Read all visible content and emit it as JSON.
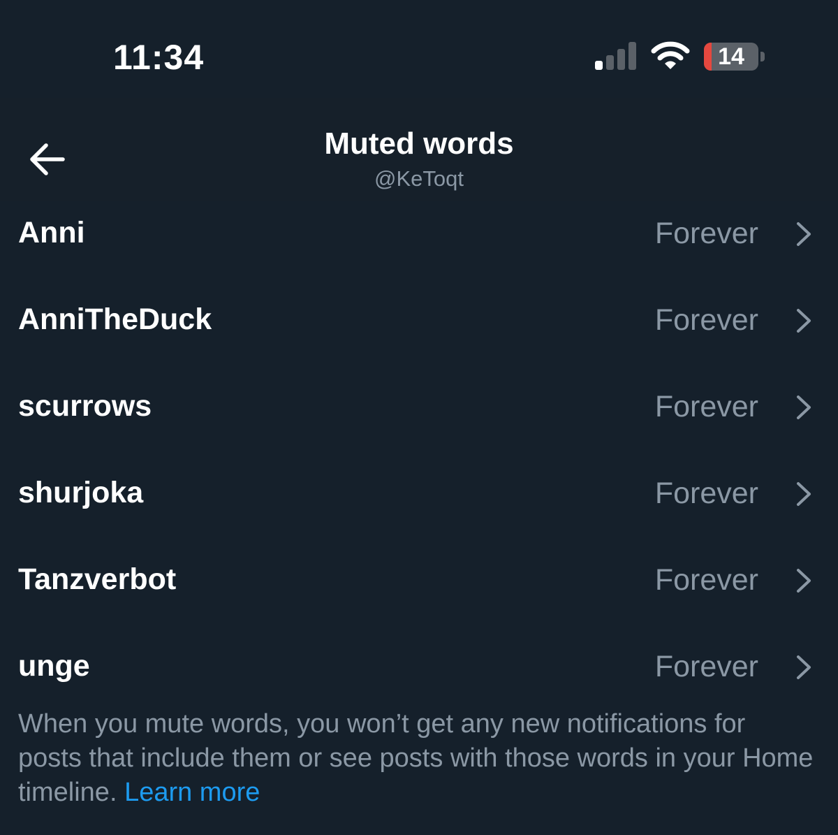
{
  "status_bar": {
    "time": "11:34",
    "signal_icon": "cellular-signal-icon",
    "signal_bars_active": 1,
    "signal_bars_total": 4,
    "wifi_icon": "wifi-icon",
    "battery_level": "14",
    "battery_fraction": 0.14,
    "battery_color": "#e5483f"
  },
  "header": {
    "back_icon": "back-arrow-icon",
    "title": "Muted words",
    "subtitle": "@KeToqt"
  },
  "muted_words": [
    {
      "word": "Anni",
      "duration": "Forever"
    },
    {
      "word": "AnniTheDuck",
      "duration": "Forever"
    },
    {
      "word": "scurrows",
      "duration": "Forever"
    },
    {
      "word": "shurjoka",
      "duration": "Forever"
    },
    {
      "word": "Tanzverbot",
      "duration": "Forever"
    },
    {
      "word": "unge",
      "duration": "Forever"
    }
  ],
  "footer": {
    "text": "When you mute words, you won’t get any new notifications for posts that include them or see posts with those words in your Home timeline.",
    "link": "Learn more"
  },
  "colors": {
    "background": "#15202b",
    "secondary_text": "#8b98a5",
    "link": "#1d9bf0"
  }
}
